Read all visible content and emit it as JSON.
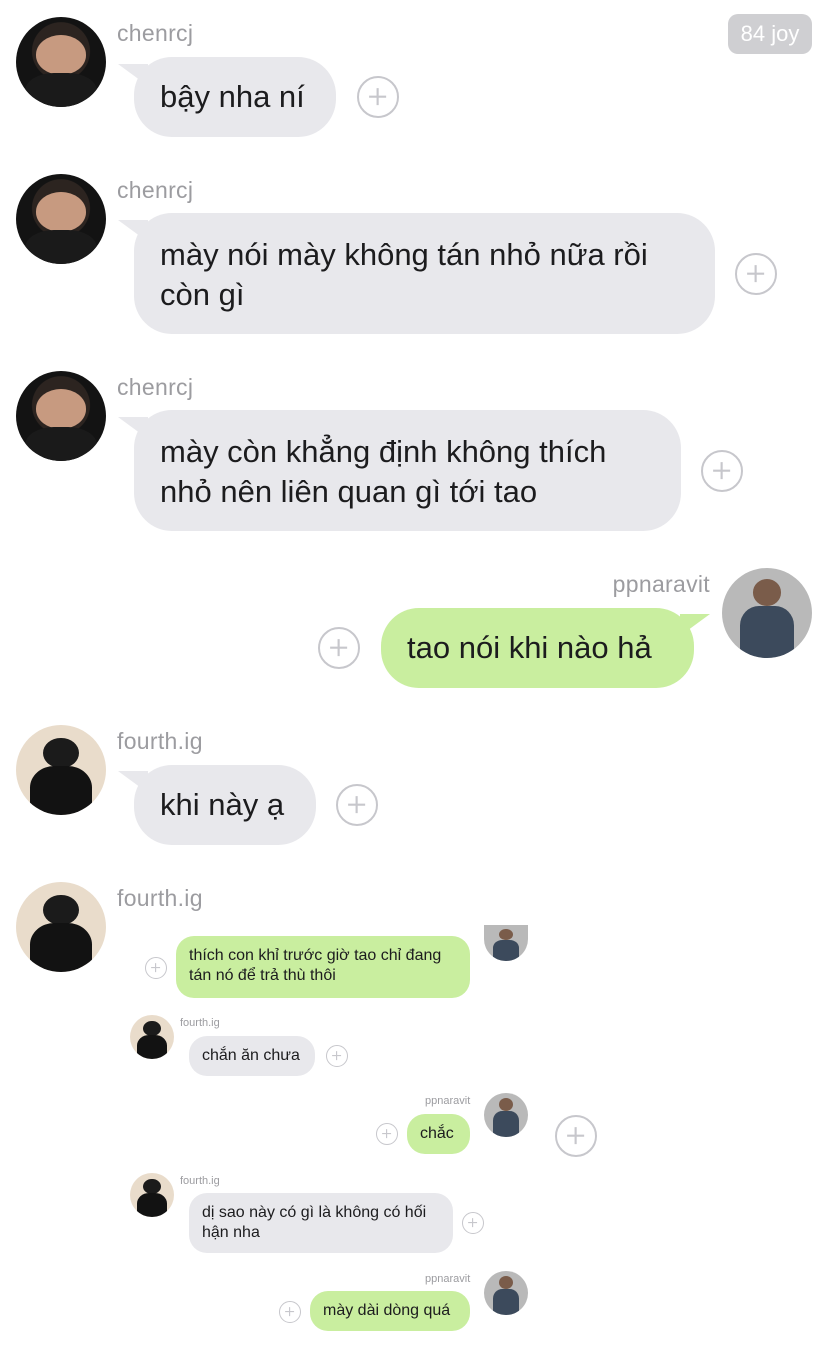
{
  "badge": {
    "text": "84 joy"
  },
  "messages": [
    {
      "user": "chenrcj",
      "text": "bậy nha ní"
    },
    {
      "user": "chenrcj",
      "lines": [
        "mày nói mày không tán nhỏ nữa rồi",
        "còn gì"
      ]
    },
    {
      "user": "chenrcj",
      "lines": [
        "mày còn khẳng định không thích",
        "nhỏ nên liên quan gì tới tao"
      ]
    },
    {
      "user": "ppnaravit",
      "text": "tao nói khi nào hả"
    },
    {
      "user": "fourth.ig",
      "text": "khi này ạ"
    },
    {
      "user": "fourth.ig"
    }
  ],
  "embedded": {
    "m1": {
      "lines": [
        "thích con khỉ trước giờ tao chỉ đang",
        "tán nó để trả thù thôi"
      ]
    },
    "m2": {
      "user": "fourth.ig",
      "text": "chắn ăn chưa"
    },
    "m3": {
      "user": "ppnaravit",
      "text": "chắc"
    },
    "m4": {
      "user": "fourth.ig",
      "lines": [
        "dị sao này có gì là không có hối",
        "hận nha"
      ]
    },
    "m5": {
      "user": "ppnaravit",
      "text": "mày dài dòng quá"
    }
  },
  "icons": {
    "add": "plus-circle-icon",
    "avatar": "avatar"
  },
  "colors": {
    "incoming": "#e8e8ec",
    "outgoing": "#c9ee9f",
    "username": "#9c9ca0"
  }
}
